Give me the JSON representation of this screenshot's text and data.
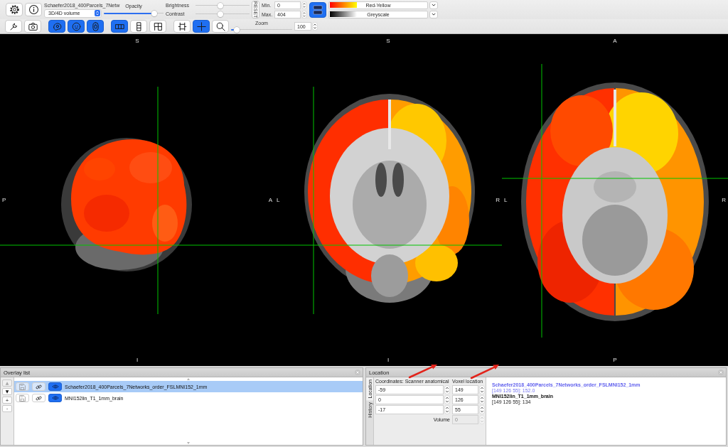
{
  "toolbar": {
    "overlay_name": "Schaefer2018_400Parcels_7Netw",
    "overlay_type": "3D/4D volume",
    "opacity": {
      "label": "Opacity",
      "level": 0.88
    },
    "brightness": {
      "label": "Brightness",
      "level": 0.45
    },
    "contrast": {
      "label": "Contrast",
      "level": 0.45
    },
    "reset_label": "RESET",
    "min": {
      "label": "Min.",
      "value": "0"
    },
    "max": {
      "label": "Max.",
      "value": "404"
    },
    "range_toggle": {
      "selected": true
    },
    "colormaps": [
      {
        "name": "Red-Yellow",
        "kind": "hot"
      },
      {
        "name": "Greyscale",
        "kind": "grey"
      }
    ]
  },
  "view_toolbar": {
    "tools": [
      {
        "selected": false
      },
      {
        "selected": false
      },
      {
        "selected": true
      },
      {
        "selected": true
      },
      {
        "selected": true
      },
      {
        "selected": true
      },
      {
        "selected": false
      },
      {
        "selected": false
      },
      {
        "selected": false
      },
      {
        "selected": true
      },
      {
        "selected": false
      }
    ],
    "zoom": {
      "label": "Zoom",
      "level": 0.05,
      "value": "100"
    }
  },
  "views": [
    {
      "kind": "sagittal",
      "top": "S",
      "left": "P",
      "right": "A",
      "bottom": "I"
    },
    {
      "kind": "coronal",
      "top": "S",
      "left": "L",
      "right": "R",
      "bottom": "I"
    },
    {
      "kind": "axial",
      "top": "A",
      "left": "L",
      "right": "R",
      "bottom": "P"
    }
  ],
  "overlay_list": {
    "title": "Overlay list",
    "controls": [
      {
        "label": "▲",
        "disabled": true
      },
      {
        "label": "▼",
        "disabled": false
      },
      {
        "label": "+",
        "disabled": false
      },
      {
        "label": "-",
        "disabled": false
      }
    ],
    "rows": [
      {
        "name": "Schaefer2018_400Parcels_7Networks_order_FSLMNI152_1mm",
        "selected": true,
        "visible": true
      },
      {
        "name": "MNI152lin_T1_1mm_brain",
        "selected": false,
        "visible": true
      }
    ]
  },
  "location": {
    "title": "Location",
    "tabs": [
      {
        "label": "Location",
        "selected": true
      },
      {
        "label": "History",
        "selected": false
      }
    ],
    "coordinates": {
      "label": "Coordinates: Scanner anatomical",
      "values": [
        "-59",
        "0",
        "-17"
      ]
    },
    "voxel": {
      "label": "Voxel location",
      "values": [
        "149",
        "126",
        "55"
      ]
    },
    "volume": {
      "label": "Volume",
      "value": "0",
      "disabled": true
    },
    "values": [
      {
        "name": "Schaefer2018_400Parcels_7Networks_order_FSLMNI152_1mm",
        "reading": "[149 126 55]: 152.0",
        "selected": true
      },
      {
        "name": "MNI152lin_T1_1mm_brain",
        "reading": "[149 126 55]: 134",
        "selected": false
      }
    ]
  }
}
